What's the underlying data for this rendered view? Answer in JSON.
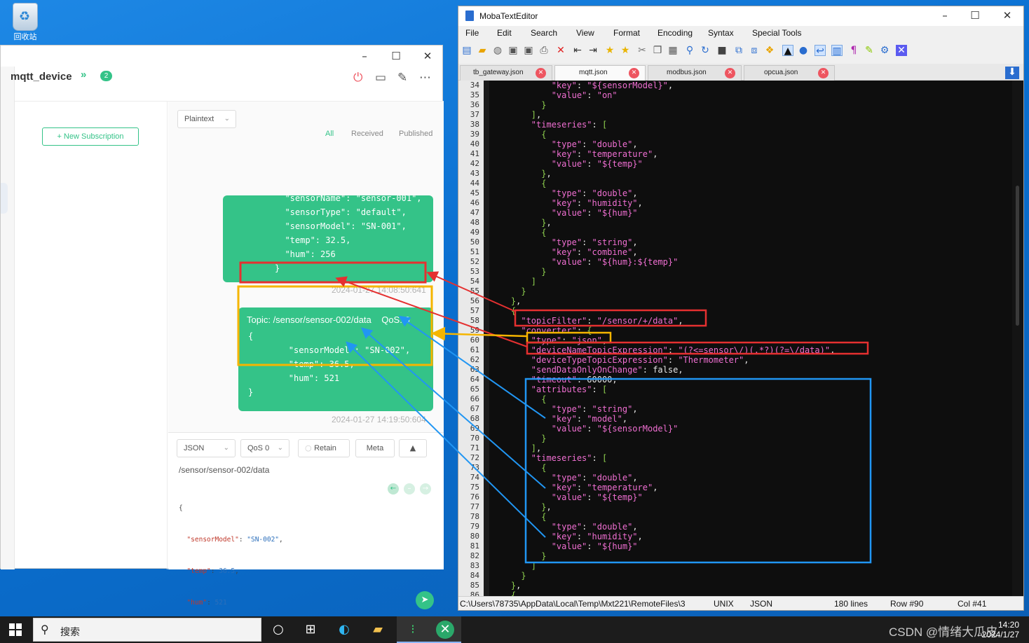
{
  "desktop": {
    "recycle_bin_label": "回收站"
  },
  "mqttx": {
    "connection_name": "mqtt_device",
    "badge_count": "2",
    "new_subscription": "+ New Subscription",
    "format_select": "Plaintext",
    "filters": [
      "All",
      "Received",
      "Published"
    ],
    "msg1_body": "  \"sensorName\": \"sensor-001\",\n  \"sensorType\": \"default\",\n  \"sensorModel\": \"SN-001\",\n  \"temp\": 32.5,\n  \"hum\": 256\n}",
    "msg1_time": "2024-01-27 14:08:50:641",
    "msg2_topic": "Topic: /sensor/sensor-002/data    QoS: 0",
    "msg2_body": "{\n        \"sensorModel\": \"SN-002\",\n        \"temp\": 36.5,\n        \"hum\": 521\n}",
    "msg2_time": "2024-01-27 14:19:50:604",
    "pub_format": "JSON",
    "pub_qos": "QoS 0",
    "retain": "Retain",
    "meta": "Meta",
    "pub_topic": "/sensor/sensor-002/data",
    "pub_payload_lines": [
      "{",
      "  \"sensorModel\": \"SN-002\",",
      "  \"temp\": 36.5,",
      "  \"hum\": 521",
      "}"
    ]
  },
  "moba": {
    "title": "MobaTextEditor",
    "menu": [
      "File",
      "Edit",
      "Search",
      "View",
      "Format",
      "Encoding",
      "Syntax",
      "Special Tools"
    ],
    "tabs": [
      "tb_gateway.json",
      "mqtt.json",
      "modbus.json",
      "opcua.json"
    ],
    "active_tab": "mqtt.json",
    "line_numbers": [
      "34",
      "35",
      "36",
      "37",
      "38",
      "39",
      "40",
      "41",
      "42",
      "43",
      "44",
      "45",
      "46",
      "47",
      "48",
      "49",
      "50",
      "51",
      "52",
      "53",
      "54",
      "55",
      "56",
      "57",
      "58",
      "59",
      "60",
      "61",
      "62",
      "63",
      "64",
      "65",
      "66",
      "67",
      "68",
      "69",
      "70",
      "71",
      "72",
      "73",
      "74",
      "75",
      "76",
      "77",
      "78",
      "79",
      "80",
      "81",
      "82",
      "83",
      "84",
      "85",
      "86"
    ],
    "code_lines": [
      "            \"key\": \"${sensorModel}\",",
      "            \"value\": \"on\"",
      "          }",
      "        ],",
      "        \"timeseries\": [",
      "          {",
      "            \"type\": \"double\",",
      "            \"key\": \"temperature\",",
      "            \"value\": \"${temp}\"",
      "          },",
      "          {",
      "            \"type\": \"double\",",
      "            \"key\": \"humidity\",",
      "            \"value\": \"${hum}\"",
      "          },",
      "          {",
      "            \"type\": \"string\",",
      "            \"key\": \"combine\",",
      "            \"value\": \"${hum}:${temp}\"",
      "          }",
      "        ]",
      "      }",
      "    },",
      "    {",
      "      \"topicFilter\": \"/sensor/+/data\",",
      "      \"converter\": {",
      "        \"type\": \"json\",",
      "        \"deviceNameTopicExpression\": \"(?<=sensor\\/)(.*?)(?=\\/data)\",",
      "        \"deviceTypeTopicExpression\": \"Thermometer\",",
      "        \"sendDataOnlyOnChange\": false,",
      "        \"timeout\": 60000,",
      "        \"attributes\": [",
      "          {",
      "            \"type\": \"string\",",
      "            \"key\": \"model\",",
      "            \"value\": \"${sensorModel}\"",
      "          }",
      "        ],",
      "        \"timeseries\": [",
      "          {",
      "            \"type\": \"double\",",
      "            \"key\": \"temperature\",",
      "            \"value\": \"${temp}\"",
      "          },",
      "          {",
      "            \"type\": \"double\",",
      "            \"key\": \"humidity\",",
      "            \"value\": \"${hum}\"",
      "          }",
      "        ]",
      "      }",
      "    },",
      "    {"
    ],
    "status": {
      "path": "C:\\Users\\78735\\AppData\\Local\\Temp\\Mxt221\\RemoteFiles\\3",
      "eol": "UNIX",
      "syntax": "JSON",
      "lines": "180 lines",
      "row": "Row #90",
      "col": "Col #41"
    }
  },
  "taskbar": {
    "search_placeholder": "搜索",
    "time": "14:20",
    "date": "2024/1/27",
    "watermark": "CSDN @情绪大瓜皮"
  },
  "colors": {
    "mqttx_green": "#34c388",
    "highlight_red": "#e53030",
    "highlight_yellow": "#f5b500",
    "highlight_blue": "#2196f3",
    "desktop_blue": "#0a6fd0"
  }
}
